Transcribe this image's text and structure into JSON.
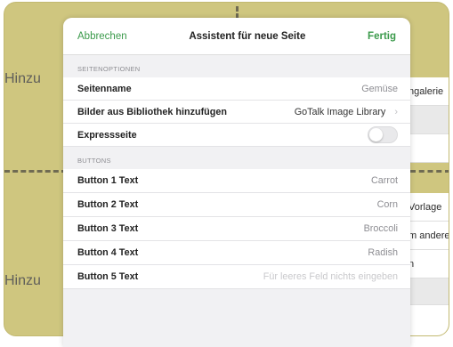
{
  "background": {
    "left_labels": [
      "Hinzu",
      "Hinzu"
    ],
    "right_panels": [
      "ngalerie",
      "",
      "",
      "Vorlage",
      "m andere",
      "n",
      "",
      ""
    ]
  },
  "modal": {
    "navbar": {
      "cancel_label": "Abbrechen",
      "title": "Assistent für neue Seite",
      "done_label": "Fertig"
    },
    "page_options": {
      "header": "SEITENOPTIONEN",
      "page_name_label": "Seitenname",
      "page_name_value": "Gemüse",
      "library_label": "Bilder aus Bibliothek hinzufügen",
      "library_value": "GoTalk Image Library",
      "express_label": "Expressseite",
      "express_enabled": false
    },
    "buttons": {
      "header": "BUTTONS",
      "rows": [
        {
          "label": "Button 1 Text",
          "value": "Carrot"
        },
        {
          "label": "Button 2 Text",
          "value": "Corn"
        },
        {
          "label": "Button 3 Text",
          "value": "Broccoli"
        },
        {
          "label": "Button 4 Text",
          "value": "Radish"
        },
        {
          "label": "Button 5 Text",
          "placeholder": "Für leeres Feld nichts eingeben"
        }
      ]
    }
  },
  "colors": {
    "accent": "#3b9a4b",
    "background_board": "#cfc67f"
  }
}
